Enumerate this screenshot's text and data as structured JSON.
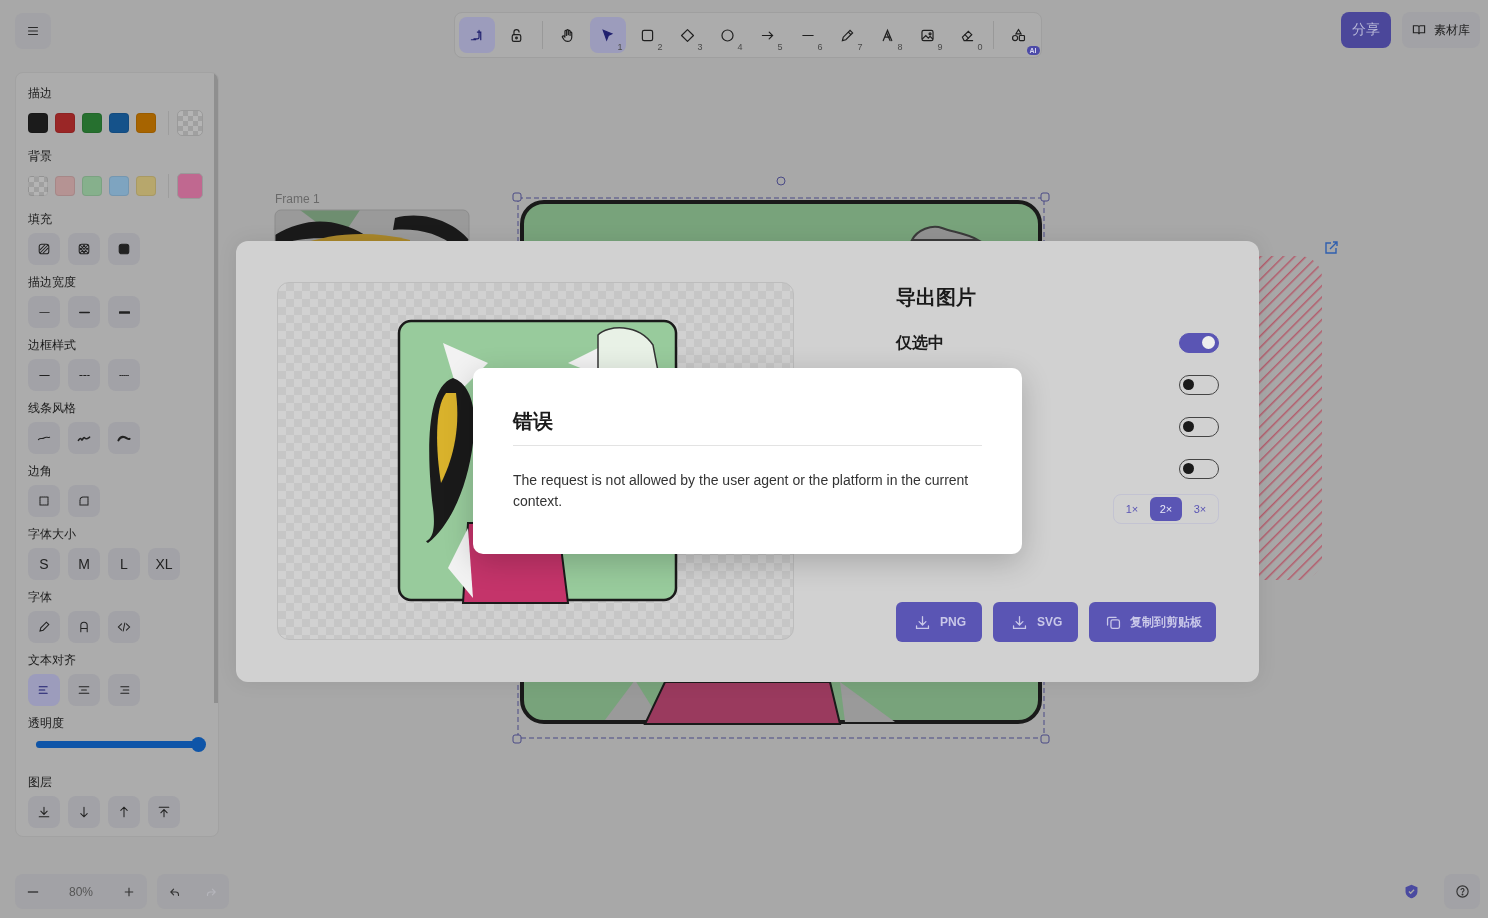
{
  "top_bar": {
    "mode_tools": [
      {
        "kind": "keep",
        "selected": true
      },
      {
        "kind": "lock",
        "selected": false
      }
    ],
    "tools": [
      {
        "kind": "hand",
        "selected": false
      },
      {
        "kind": "select",
        "shortcut": "1",
        "selected": true
      },
      {
        "kind": "rectangle",
        "shortcut": "2",
        "selected": false
      },
      {
        "kind": "diamond",
        "shortcut": "3",
        "selected": false
      },
      {
        "kind": "ellipse",
        "shortcut": "4",
        "selected": false
      },
      {
        "kind": "arrow",
        "shortcut": "5",
        "selected": false
      },
      {
        "kind": "line",
        "shortcut": "6",
        "selected": false
      },
      {
        "kind": "pencil",
        "shortcut": "7",
        "selected": false
      },
      {
        "kind": "text",
        "shortcut": "8",
        "selected": false
      },
      {
        "kind": "image",
        "shortcut": "9",
        "selected": false
      },
      {
        "kind": "eraser",
        "shortcut": "0",
        "selected": false
      }
    ],
    "extra_tools": [
      {
        "kind": "shapes",
        "badge": "AI",
        "selected": false
      }
    ],
    "share_button": "分享",
    "library_button": "素材库"
  },
  "properties": {
    "stroke": {
      "label": "描边",
      "swatches": [
        {
          "kind": "color",
          "color": "#1b1b1b"
        },
        {
          "kind": "color",
          "color": "#9a2626"
        },
        {
          "kind": "color",
          "color": "#26702f"
        },
        {
          "kind": "color",
          "color": "#15528a"
        },
        {
          "kind": "color",
          "color": "#a76400"
        }
      ],
      "current": {
        "kind": "transparent"
      }
    },
    "background": {
      "label": "背景",
      "swatches": [
        {
          "kind": "transparent"
        },
        {
          "kind": "color",
          "color": "#b59393"
        },
        {
          "kind": "color",
          "color": "#86b08c"
        },
        {
          "kind": "color",
          "color": "#7ea4c0"
        },
        {
          "kind": "color",
          "color": "#b7a76c"
        }
      ],
      "current": {
        "kind": "color",
        "color": "#c06890"
      }
    },
    "groups": [
      {
        "label": "填充",
        "options": [
          {
            "kind": "hachure",
            "selected": false
          },
          {
            "kind": "cross-hatch",
            "selected": false
          },
          {
            "kind": "solid",
            "selected": false
          }
        ]
      },
      {
        "label": "描边宽度",
        "options": [
          {
            "kind": "thin",
            "selected": false
          },
          {
            "kind": "bold",
            "selected": false
          },
          {
            "kind": "extra-bold",
            "selected": false
          }
        ]
      },
      {
        "label": "边框样式",
        "options": [
          {
            "kind": "solid-line",
            "selected": false
          },
          {
            "kind": "dashed",
            "selected": false
          },
          {
            "kind": "dotted",
            "selected": false
          }
        ]
      },
      {
        "label": "线条风格",
        "options": [
          {
            "kind": "architect",
            "selected": false
          },
          {
            "kind": "artist",
            "selected": false
          },
          {
            "kind": "cartoonist",
            "selected": false
          }
        ]
      },
      {
        "label": "边角",
        "options": [
          {
            "kind": "sharp",
            "selected": false
          },
          {
            "kind": "round",
            "selected": false
          }
        ]
      },
      {
        "label": "字体大小",
        "options": [
          {
            "kind": "size",
            "text": "S",
            "selected": false
          },
          {
            "kind": "size",
            "text": "M",
            "selected": false
          },
          {
            "kind": "size",
            "text": "L",
            "selected": false
          },
          {
            "kind": "size",
            "text": "XL",
            "selected": false
          }
        ]
      },
      {
        "label": "字体",
        "options": [
          {
            "kind": "hand-font",
            "selected": false
          },
          {
            "kind": "normal-font",
            "selected": false
          },
          {
            "kind": "code-font",
            "selected": false
          }
        ]
      },
      {
        "label": "文本对齐",
        "options": [
          {
            "kind": "align-left",
            "selected": true
          },
          {
            "kind": "align-center",
            "selected": false
          },
          {
            "kind": "align-right",
            "selected": false
          }
        ]
      }
    ],
    "opacity": {
      "label": "透明度",
      "level": 1
    },
    "layers": {
      "label": "图层",
      "options": [
        {
          "kind": "send-to-back"
        },
        {
          "kind": "send-backward"
        },
        {
          "kind": "bring-forward"
        },
        {
          "kind": "bring-to-front"
        }
      ]
    }
  },
  "canvas": {
    "frame_label": "Frame 1"
  },
  "zoom": {
    "value": "80%"
  },
  "history": [
    {
      "kind": "undo",
      "disabled": false
    },
    {
      "kind": "redo",
      "disabled": true
    }
  ],
  "export_dialog": {
    "title": "导出图片",
    "toggles": [
      {
        "label": "仅选中",
        "on": true
      },
      {
        "on": false
      },
      {
        "on": false
      },
      {
        "on": false
      }
    ],
    "scales": [
      {
        "label": "1×",
        "selected": false
      },
      {
        "label": "2×",
        "selected": true
      },
      {
        "label": "3×",
        "selected": false
      }
    ],
    "buttons": [
      {
        "kind": "download",
        "label": "PNG"
      },
      {
        "kind": "download",
        "label": "SVG"
      },
      {
        "kind": "copy",
        "label": "复制到剪贴板"
      }
    ]
  },
  "error_dialog": {
    "title": "错误",
    "message": "The request is not allowed by the user agent or the platform in the current context."
  }
}
